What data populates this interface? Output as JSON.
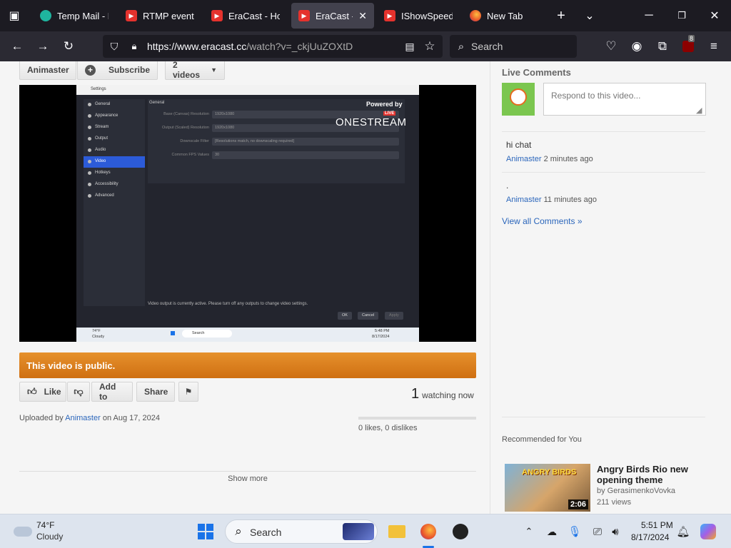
{
  "browser": {
    "tabs": [
      {
        "label": "Temp Mail - D",
        "favicon": "tempmail-icon"
      },
      {
        "label": "RTMP event",
        "favicon": "youtube-icon"
      },
      {
        "label": "EraCast - Hom",
        "favicon": "youtube-icon"
      },
      {
        "label": "EraCast - liv",
        "favicon": "youtube-icon",
        "active": true
      },
      {
        "label": "IShowSpeed -",
        "favicon": "youtube-icon"
      },
      {
        "label": "New Tab",
        "favicon": "firefox-icon"
      }
    ],
    "url_domain": "https://www.eracast.cc",
    "url_path": "/watch?v=_ckjUuZOXtD",
    "search_placeholder": "Search",
    "extension_badge": "8"
  },
  "channel": {
    "name": "Animaster",
    "subscribe_label": "Subscribe",
    "videos_label": "2 videos"
  },
  "video_frame": {
    "window_title": "Settings",
    "sidebar_items": [
      "General",
      "Appearance",
      "Stream",
      "Output",
      "Audio",
      "Video",
      "Hotkeys",
      "Accessibility",
      "Advanced"
    ],
    "selected_item": "Video",
    "panel_heading": "General",
    "rows": [
      {
        "label": "Base (Canvas) Resolution",
        "value": "1920x1080"
      },
      {
        "label": "Output (Scaled) Resolution",
        "value": "1920x1080"
      },
      {
        "label": "Downscale Filter",
        "value": "[Resolutions match, no downscaling required]"
      },
      {
        "label": "Common FPS Values",
        "value": "30"
      }
    ],
    "powered_by": "Powered by",
    "overlay_brand": "ONESTREAM",
    "overlay_live": "LIVE",
    "notice": "Video output is currently active. Please turn off any outputs to change video settings.",
    "buttons": [
      "OK",
      "Cancel",
      "Apply"
    ],
    "taskbar_weather": "74°F",
    "taskbar_weather_desc": "Cloudy",
    "taskbar_search": "Search",
    "taskbar_time": "5:48 PM",
    "taskbar_date": "8/17/2024"
  },
  "status": {
    "public_label": "This video is public."
  },
  "actions": {
    "like_label": "Like",
    "addto_label": "Add to",
    "share_label": "Share"
  },
  "watching": {
    "count": "1",
    "label": "watching now"
  },
  "upload": {
    "prefix": "Uploaded by",
    "user": "Animaster",
    "on": "on Aug 17, 2024"
  },
  "likes": {
    "text": "0 likes, 0 dislikes",
    "ratio": 0
  },
  "show_more": "Show more",
  "comments": {
    "title": "Live Comments",
    "placeholder": "Respond to this video...",
    "items": [
      {
        "text": "hi chat",
        "user": "Animaster",
        "time": "2 minutes ago"
      },
      {
        "text": ".",
        "user": "Animaster",
        "time": "11 minutes ago"
      }
    ],
    "view_all": "View all Comments »"
  },
  "recommended": {
    "title": "Recommended for You",
    "items": [
      {
        "name": "Angry Birds Rio new opening theme",
        "by": "by GerasimenkoVovka",
        "views": "211 views",
        "duration": "2:06",
        "thumb_text": "ANGRY BIRDS"
      }
    ]
  },
  "taskbar": {
    "temp": "74°F",
    "condition": "Cloudy",
    "search_label": "Search",
    "time": "5:51 PM",
    "date": "8/17/2024"
  },
  "colors": {
    "public_bar": "#d97a1c",
    "link": "#2b66bb",
    "chrome_dark": "#1c1b22"
  }
}
